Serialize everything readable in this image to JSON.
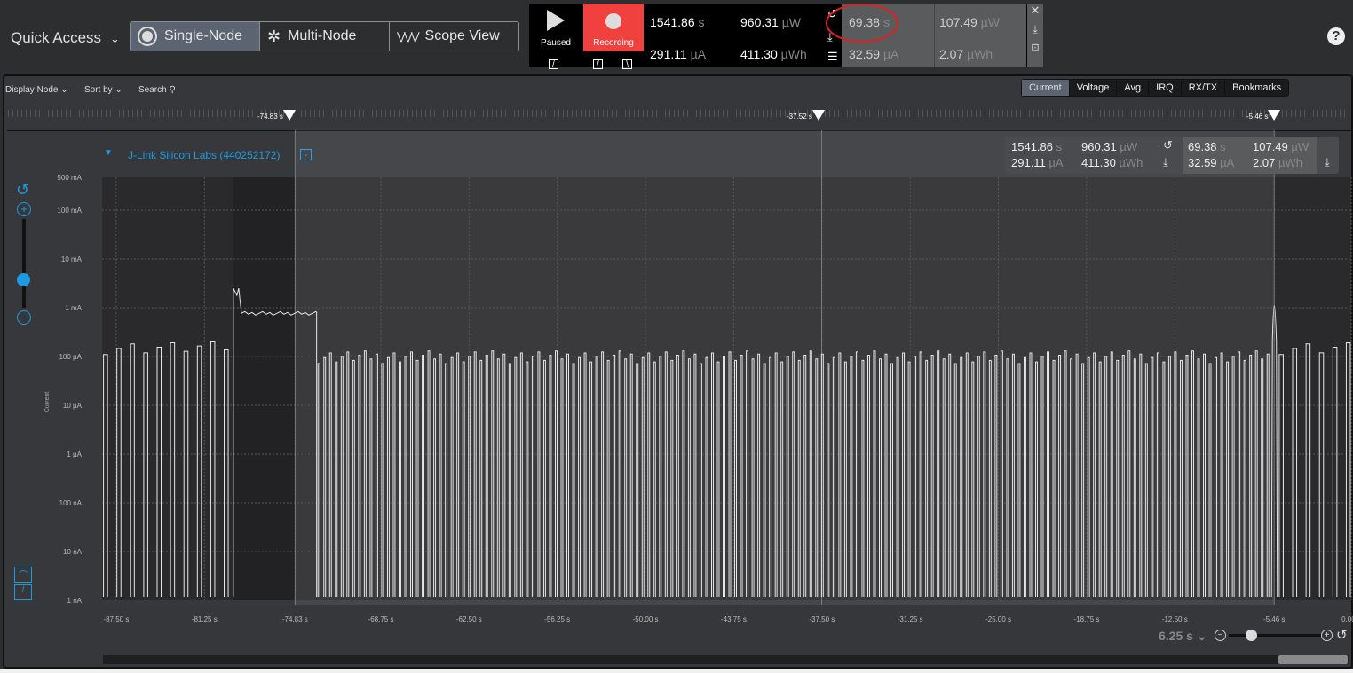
{
  "header": {
    "quick_access": "Quick Access",
    "modes": [
      {
        "label": "Single-Node",
        "active": true
      },
      {
        "label": "Multi-Node",
        "active": false
      },
      {
        "label": "Scope View",
        "active": false
      }
    ]
  },
  "controls": {
    "paused_label": "Paused",
    "recording_label": "Recording",
    "recording_color": "#f0413f",
    "totals": {
      "time": "1541.86",
      "time_unit": "s",
      "current": "291.11",
      "current_unit": "µA",
      "power": "960.31",
      "power_unit": "µW",
      "energy": "411.30",
      "energy_unit": "µWh"
    },
    "selection": {
      "time": "69.38",
      "time_unit": "s",
      "current": "32.59",
      "current_unit": "µA",
      "power": "107.49",
      "power_unit": "µW",
      "energy": "2.07",
      "energy_unit": "µWh"
    }
  },
  "toolbar": {
    "display_node": "Display Node",
    "sort_by": "Sort by",
    "search": "Search",
    "tabs": [
      {
        "label": "Current",
        "active": true
      },
      {
        "label": "Voltage"
      },
      {
        "label": "Avg"
      },
      {
        "label": "IRQ"
      },
      {
        "label": "RX/TX"
      },
      {
        "label": "Bookmarks"
      }
    ]
  },
  "markers": [
    "-74.83 s",
    "-37.52 s",
    "-5.46 s"
  ],
  "node": {
    "name": "J-Link Silicon Labs (440252172)"
  },
  "axis": {
    "ylabel": "Current",
    "zoom_value": "6.25 s"
  },
  "chart_data": {
    "type": "line",
    "ylabel": "Current",
    "yscale": "log",
    "yticks": [
      "500 mA",
      "100 mA",
      "10 mA",
      "1 mA",
      "100 µA",
      "10 µA",
      "1 µA",
      "100 nA",
      "10 nA",
      "1 nA"
    ],
    "xticks": [
      "-87.50 s",
      "-81.25 s",
      "-74.83 s",
      "-68.75 s",
      "-62.50 s",
      "-56.25 s",
      "-50.00 s",
      "-43.75 s",
      "-37.50 s",
      "-31.25 s",
      "-25.00 s",
      "-18.75 s",
      "-12.50 s",
      "-5.46 s",
      "0.00 s"
    ],
    "xlim_s": [
      -88.5,
      0
    ],
    "selection_s": [
      -74.83,
      -5.46
    ],
    "segments": [
      {
        "from_s": -88.5,
        "to_s": -79.2,
        "shape": "pulses",
        "period_s": 0.95,
        "peak_uA": 200,
        "base_nA": 1
      },
      {
        "from_s": -79.2,
        "to_s": -73.3,
        "shape": "plateau",
        "level_mA": 0.8,
        "peak_mA": 2.5
      },
      {
        "from_s": -73.3,
        "to_s": -5.9,
        "shape": "pulses",
        "period_s": 0.41,
        "peak_uA": 130,
        "base_nA": 1
      },
      {
        "from_s": -5.46,
        "to_s": -5.3,
        "shape": "spike",
        "peak_mA": 4
      },
      {
        "from_s": -5.2,
        "to_s": 0,
        "shape": "pulses",
        "period_s": 0.95,
        "peak_uA": 200,
        "base_nA": 1
      }
    ]
  }
}
